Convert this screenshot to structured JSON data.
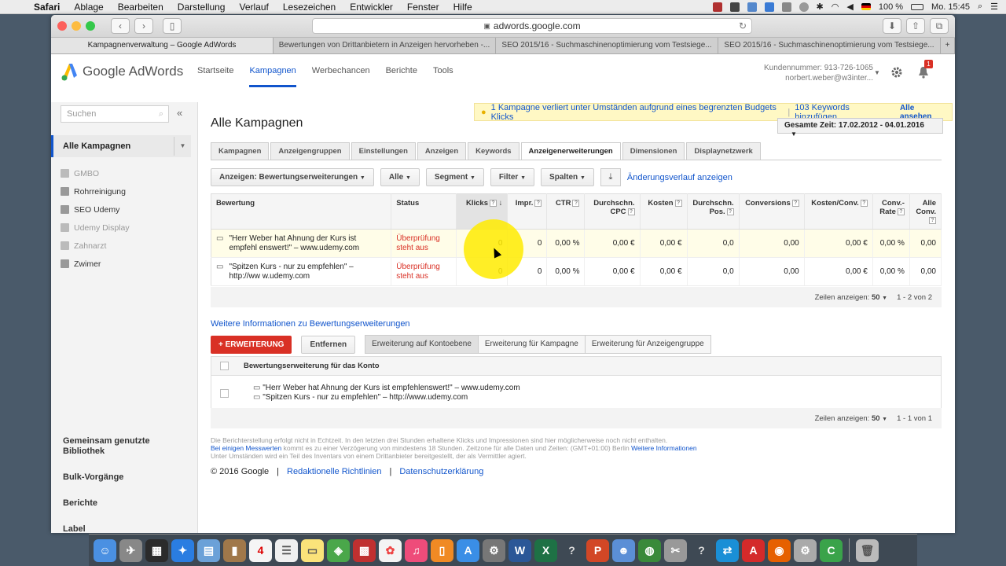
{
  "menubar": {
    "app": "Safari",
    "items": [
      "Ablage",
      "Bearbeiten",
      "Darstellung",
      "Verlauf",
      "Lesezeichen",
      "Entwickler",
      "Fenster",
      "Hilfe"
    ],
    "battery": "100 %",
    "clock": "Mo. 15:45"
  },
  "browser": {
    "url": "adwords.google.com",
    "tabs": [
      "Kampagnenverwaltung – Google AdWords",
      "Bewertungen von Drittanbietern in Anzeigen hervorheben -...",
      "SEO 2015/16 - Suchmaschinenoptimierung vom Testsiege...",
      "SEO 2015/16 - Suchmaschinenoptimierung vom Testsiege..."
    ]
  },
  "header": {
    "logo": "Google AdWords",
    "nav": [
      "Startseite",
      "Kampagnen",
      "Werbechancen",
      "Berichte",
      "Tools"
    ],
    "account_number": "Kundennummer: 913-726-1065",
    "account_email": "norbert.weber@w3inter...",
    "notification_count": "1"
  },
  "sidebar": {
    "search_placeholder": "Suchen",
    "all_campaigns": "Alle Kampagnen",
    "campaigns": [
      {
        "name": "GMBO",
        "active": false
      },
      {
        "name": "Rohrreinigung",
        "active": true
      },
      {
        "name": "SEO Udemy",
        "active": true
      },
      {
        "name": "Udemy Display",
        "active": false
      },
      {
        "name": "Zahnarzt",
        "active": false
      },
      {
        "name": "Zwimer",
        "active": true
      }
    ],
    "bottom": [
      "Gemeinsam genutzte Bibliothek",
      "Bulk-Vorgänge",
      "Berichte",
      "Label"
    ]
  },
  "main": {
    "title": "Alle Kampagnen",
    "alert": {
      "msg1": "1 Kampagne verliert unter Umständen aufgrund eines begrenzten Budgets Klicks",
      "msg2": "103 Keywords hinzufügen...",
      "view_all": "Alle ansehen"
    },
    "daterange": "Gesamte Zeit: 17.02.2012 - 04.01.2016",
    "tabs": [
      "Kampagnen",
      "Anzeigengruppen",
      "Einstellungen",
      "Anzeigen",
      "Keywords",
      "Anzeigenerweiterungen",
      "Dimensionen",
      "Displaynetzwerk"
    ],
    "controls": {
      "view": "Anzeigen: Bewertungserweiterungen",
      "all": "Alle",
      "segment": "Segment",
      "filter": "Filter",
      "columns": "Spalten",
      "history": "Änderungsverlauf anzeigen"
    },
    "table": {
      "headers": [
        "Bewertung",
        "Status",
        "Klicks",
        "Impr.",
        "CTR",
        "Durchschn. CPC",
        "Kosten",
        "Durchschn. Pos.",
        "Conversions",
        "Kosten/Conv.",
        "Conv.-Rate",
        "Alle Conv."
      ],
      "rows": [
        {
          "text": "\"Herr Weber hat Ahnung der Kurs ist empfehl enswert!\" – www.udemy.com",
          "status": "Überprüfung steht aus",
          "values": [
            "0",
            "0",
            "0,00 %",
            "0,00 €",
            "0,00 €",
            "0,0",
            "0,00",
            "0,00 €",
            "0,00 %",
            "0,00"
          ]
        },
        {
          "text": "\"Spitzen Kurs - nur zu empfehlen\" – http://ww w.udemy.com",
          "status": "Überprüfung steht aus",
          "values": [
            "0",
            "0",
            "0,00 %",
            "0,00 €",
            "0,00 €",
            "0,0",
            "0,00",
            "0,00 €",
            "0,00 %",
            "0,00"
          ]
        }
      ],
      "rows_label": "Zeilen anzeigen:",
      "rows_value": "50",
      "range": "1 - 2 von 2"
    },
    "more_info": "Weitere Informationen zu Bewertungserweiterungen",
    "add_button": "ERWEITERUNG",
    "remove_button": "Entfernen",
    "level_tabs": [
      "Erweiterung auf Kontoebene",
      "Erweiterung für Kampagne",
      "Erweiterung für Anzeigengruppe"
    ],
    "account_table": {
      "header": "Bewertungserweiterung für das Konto",
      "line1": "\"Herr Weber hat Ahnung der Kurs ist empfehlenswert!\" – www.udemy.com",
      "line2": "\"Spitzen Kurs - nur zu empfehlen\" – http://www.udemy.com",
      "rows_label": "Zeilen anzeigen:",
      "rows_value": "50",
      "range": "1 - 1 von 1"
    },
    "disclaimer": {
      "line1": "Die Berichterstellung erfolgt nicht in Echtzeit. In den letzten drei Stunden erhaltene Klicks und Impressionen sind hier möglicherweise noch nicht enthalten.",
      "line2_link": "Bei einigen Messwerten",
      "line2": "kommt es zu einer Verzögerung von mindestens 18 Stunden. Zeitzone für alle Daten und Zeiten: (GMT+01:00) Berlin",
      "line2_link2": "Weitere Informationen",
      "line3": "Unter Umständen wird ein Teil des Inventars von einem Drittanbieter bereitgestellt, der als Vermittler agiert."
    },
    "footer": {
      "copyright": "© 2016 Google",
      "link1": "Redaktionelle Richtlinien",
      "link2": "Datenschutzerklärung"
    }
  }
}
